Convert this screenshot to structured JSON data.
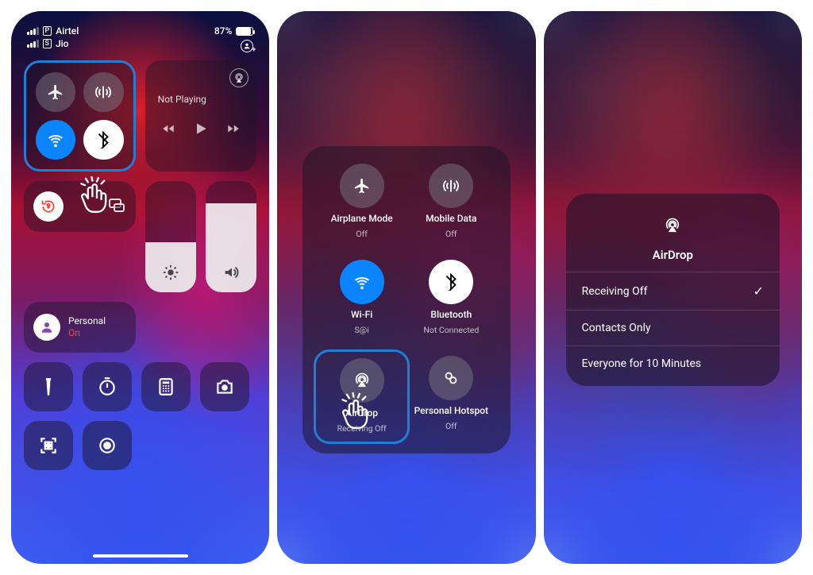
{
  "status": {
    "carrier1": "Airtel",
    "sim1": "P",
    "carrier2": "Jio",
    "sim2": "S",
    "battery_pct": "87%"
  },
  "panel1": {
    "media": {
      "not_playing": "Not Playing"
    },
    "focus": {
      "label": "Personal",
      "state": "On"
    },
    "brightness_pct": 45,
    "volume_pct": 80
  },
  "panel2": {
    "items": [
      {
        "label": "Airplane Mode",
        "sub": "Off"
      },
      {
        "label": "Mobile Data",
        "sub": "Off"
      },
      {
        "label": "Wi-Fi",
        "sub": "S@i"
      },
      {
        "label": "Bluetooth",
        "sub": "Not Connected"
      },
      {
        "label": "AirDrop",
        "sub": "Receiving Off"
      },
      {
        "label": "Personal Hotspot",
        "sub": "Off"
      }
    ]
  },
  "panel3": {
    "title": "AirDrop",
    "options": [
      {
        "label": "Receiving Off",
        "selected": true
      },
      {
        "label": "Contacts Only",
        "selected": false
      },
      {
        "label": "Everyone for 10 Minutes",
        "selected": false
      }
    ]
  }
}
